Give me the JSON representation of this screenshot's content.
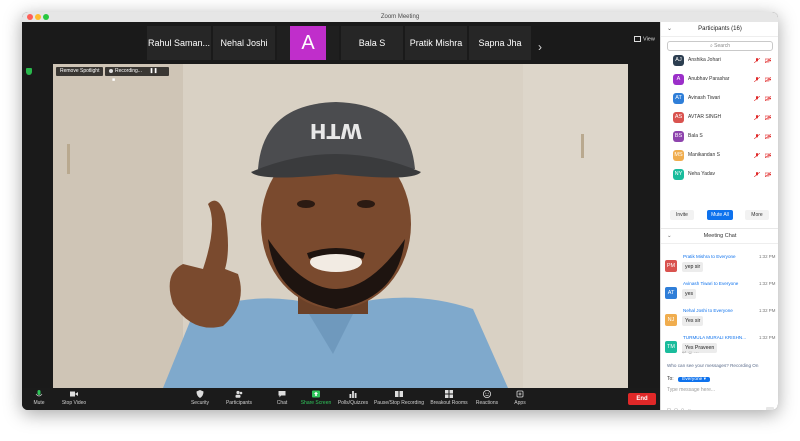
{
  "window": {
    "title": "Zoom Meeting"
  },
  "thumbnails": [
    {
      "name": "Rahul Saman..."
    },
    {
      "name": "Nehal Joshi"
    },
    {
      "name": "",
      "avatar_letter": "A",
      "avatar_color": "#c02ecb"
    },
    {
      "name": "Bala S"
    },
    {
      "name": "Pratik Mishra"
    },
    {
      "name": "Sapna Jha"
    }
  ],
  "view_label": "View",
  "video": {
    "remove_spotlight": "Remove Spotlight",
    "recording": "Recording..."
  },
  "toolbar": {
    "mute": "Mute",
    "stop_video": "Stop Video",
    "security": "Security",
    "participants": "Participants",
    "participants_count": "16",
    "chat": "Chat",
    "share_screen": "Share Screen",
    "polls": "Polls/Quizzes",
    "pause_recording": "Pause/Stop Recording",
    "breakout": "Breakout Rooms",
    "reactions": "Reactions",
    "apps": "Apps",
    "end": "End"
  },
  "participants_panel": {
    "title": "Participants (16)",
    "search_placeholder": "Search",
    "list": [
      {
        "initials": "AJ",
        "name": "Anshika Johari",
        "color": "#2c3e50"
      },
      {
        "initials": "A",
        "name": "Anubhav Parashar",
        "color": "#9b2fc9"
      },
      {
        "initials": "AT",
        "name": "Avinash Tiwari",
        "color": "#2f7ed8"
      },
      {
        "initials": "AS",
        "name": "AVTAR SINGH",
        "color": "#d9534f"
      },
      {
        "initials": "BS",
        "name": "Bala S",
        "color": "#8e44ad"
      },
      {
        "initials": "MS",
        "name": "Manikandan S",
        "color": "#f0ad4e"
      },
      {
        "initials": "NY",
        "name": "Neha Yadav",
        "color": "#1abc9c"
      }
    ],
    "invite": "Invite",
    "mute_all": "Mute All",
    "more": "More"
  },
  "chat_panel": {
    "title": "Meeting Chat",
    "messages": [
      {
        "initials": "PM",
        "color": "#d9534f",
        "from": "Pratik Mishra",
        "to": "to Everyone",
        "time": "1:32 PM",
        "text": "yep sir"
      },
      {
        "initials": "AT",
        "color": "#2f7ed8",
        "from": "Avinash Tiwari",
        "to": "to Everyone",
        "time": "1:32 PM",
        "text": "yes"
      },
      {
        "initials": "NJ",
        "color": "#f0ad4e",
        "from": "Nehal Joshi",
        "to": "to Everyone",
        "time": "1:32 PM",
        "text": "Yes sir"
      },
      {
        "initials": "TM",
        "color": "#1abc9c",
        "from": "TURMULA MURALI KRISHN...",
        "to": "",
        "time": "1:32 PM",
        "text": "Yes Praveen"
      }
    ],
    "who_can_see": "Who can see your messages? Recording On",
    "to_label": "To:",
    "to_value": "Everyone",
    "type_placeholder": "Type message here..."
  }
}
